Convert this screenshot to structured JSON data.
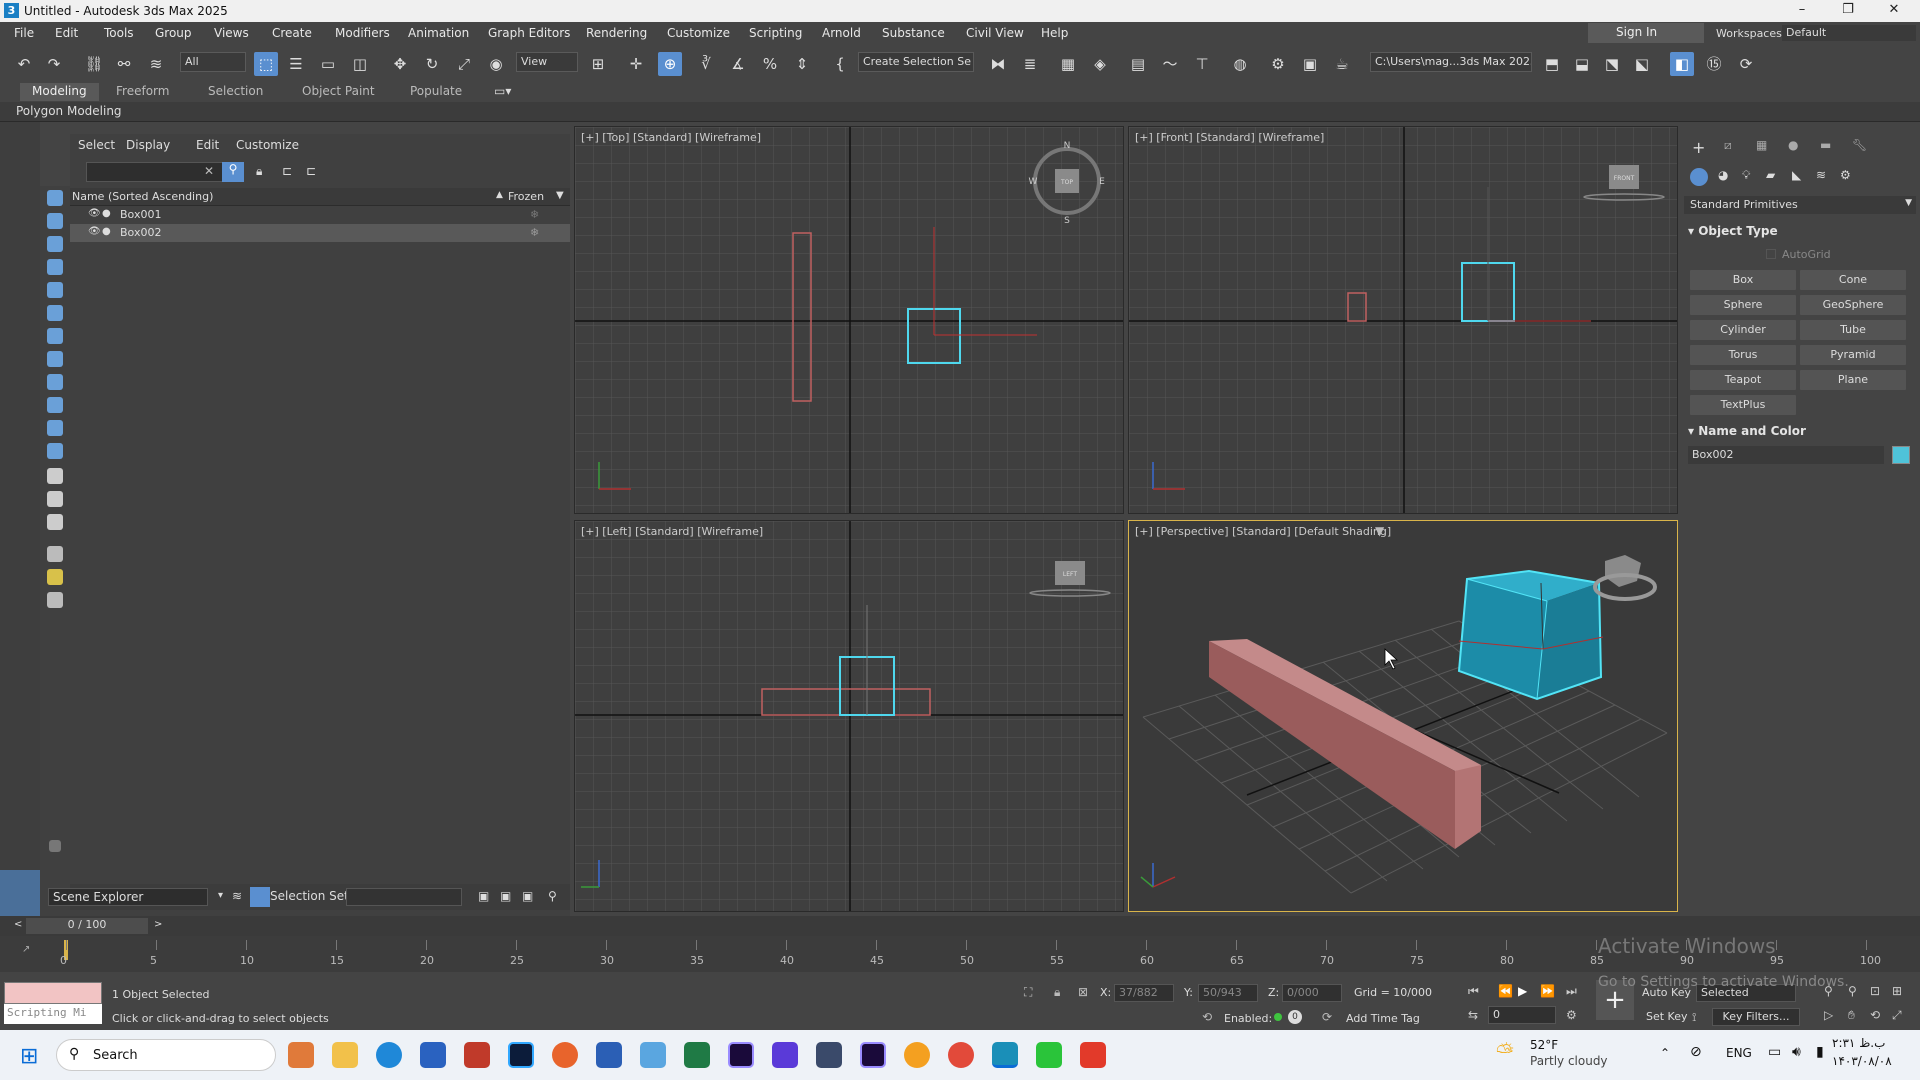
{
  "window": {
    "title": "Untitled - Autodesk 3ds Max 2025"
  },
  "menu": [
    "File",
    "Edit",
    "Tools",
    "Group",
    "Views",
    "Create",
    "Modifiers",
    "Animation",
    "Graph Editors",
    "Rendering",
    "Customize",
    "Scripting",
    "Arnold",
    "Substance",
    "Civil View",
    "Help"
  ],
  "account": {
    "signin": "Sign In",
    "workspaces_label": "Workspaces:",
    "workspace": "Default"
  },
  "toolbar": {
    "filter": "All",
    "ref_coord": "View",
    "selection_set": "Create Selection Se",
    "project_path": "C:\\Users\\mag...3ds Max 2025"
  },
  "ribbon": {
    "tabs": [
      "Modeling",
      "Freeform",
      "Selection",
      "Object Paint",
      "Populate"
    ],
    "subtab": "Polygon Modeling"
  },
  "scene_explorer": {
    "menu": [
      "Select",
      "Display",
      "Edit",
      "Customize"
    ],
    "col_name": "Name (Sorted Ascending)",
    "col_frozen": "Frozen",
    "items": [
      {
        "name": "Box001"
      },
      {
        "name": "Box002"
      }
    ],
    "footer_name": "Scene Explorer",
    "selection_set_label": "Selection Set:"
  },
  "viewports": {
    "top": "[+] [Top] [Standard] [Wireframe]",
    "front": "[+] [Front] [Standard] [Wireframe]",
    "left": "[+] [Left] [Standard] [Wireframe]",
    "perspective": "[+] [Perspective] [Standard] [Default Shading]",
    "compass": {
      "n": "N",
      "s": "S",
      "e": "E",
      "w": "W"
    },
    "cube_top": "TOP",
    "cube_front": "FRONT",
    "cube_left": "LEFT"
  },
  "command_panel": {
    "category": "Standard Primitives",
    "object_type": "Object Type",
    "autogrid": "AutoGrid",
    "buttons": [
      "Box",
      "Cone",
      "Sphere",
      "GeoSphere",
      "Cylinder",
      "Tube",
      "Torus",
      "Pyramid",
      "Teapot",
      "Plane",
      "TextPlus"
    ],
    "name_color": "Name and Color",
    "object_name": "Box002",
    "object_color": "#4fc3d9"
  },
  "timeline": {
    "frame": "0 / 100",
    "ticks": [
      "0",
      "5",
      "10",
      "15",
      "20",
      "25",
      "30",
      "35",
      "40",
      "45",
      "50",
      "55",
      "60",
      "65",
      "70",
      "75",
      "80",
      "85",
      "90",
      "95",
      "100"
    ]
  },
  "status": {
    "selected": "1 Object Selected",
    "prompt": "Click or click-and-drag to select objects",
    "script": "Scripting Mi",
    "x_label": "X:",
    "x": "37/882",
    "y_label": "Y:",
    "y": "50/943",
    "z_label": "Z:",
    "z": "0/000",
    "grid": "Grid = 10/000",
    "enabled": "Enabled:",
    "add_time_tag": "Add Time Tag",
    "auto_key": "Auto Key",
    "set_key": "Set Key",
    "key_mode": "Selected",
    "key_filters": "Key Filters...",
    "frame_field": "0",
    "activate1": "Activate Windows",
    "activate2": "Go to Settings to activate Windows."
  },
  "taskbar": {
    "search": "Search",
    "temp": "52°F",
    "weather": "Partly cloudy",
    "lang": "ENG",
    "time": "۲:۳۱ ب.ظ",
    "date": "۱۴۰۳/۰۸/۰۸"
  }
}
